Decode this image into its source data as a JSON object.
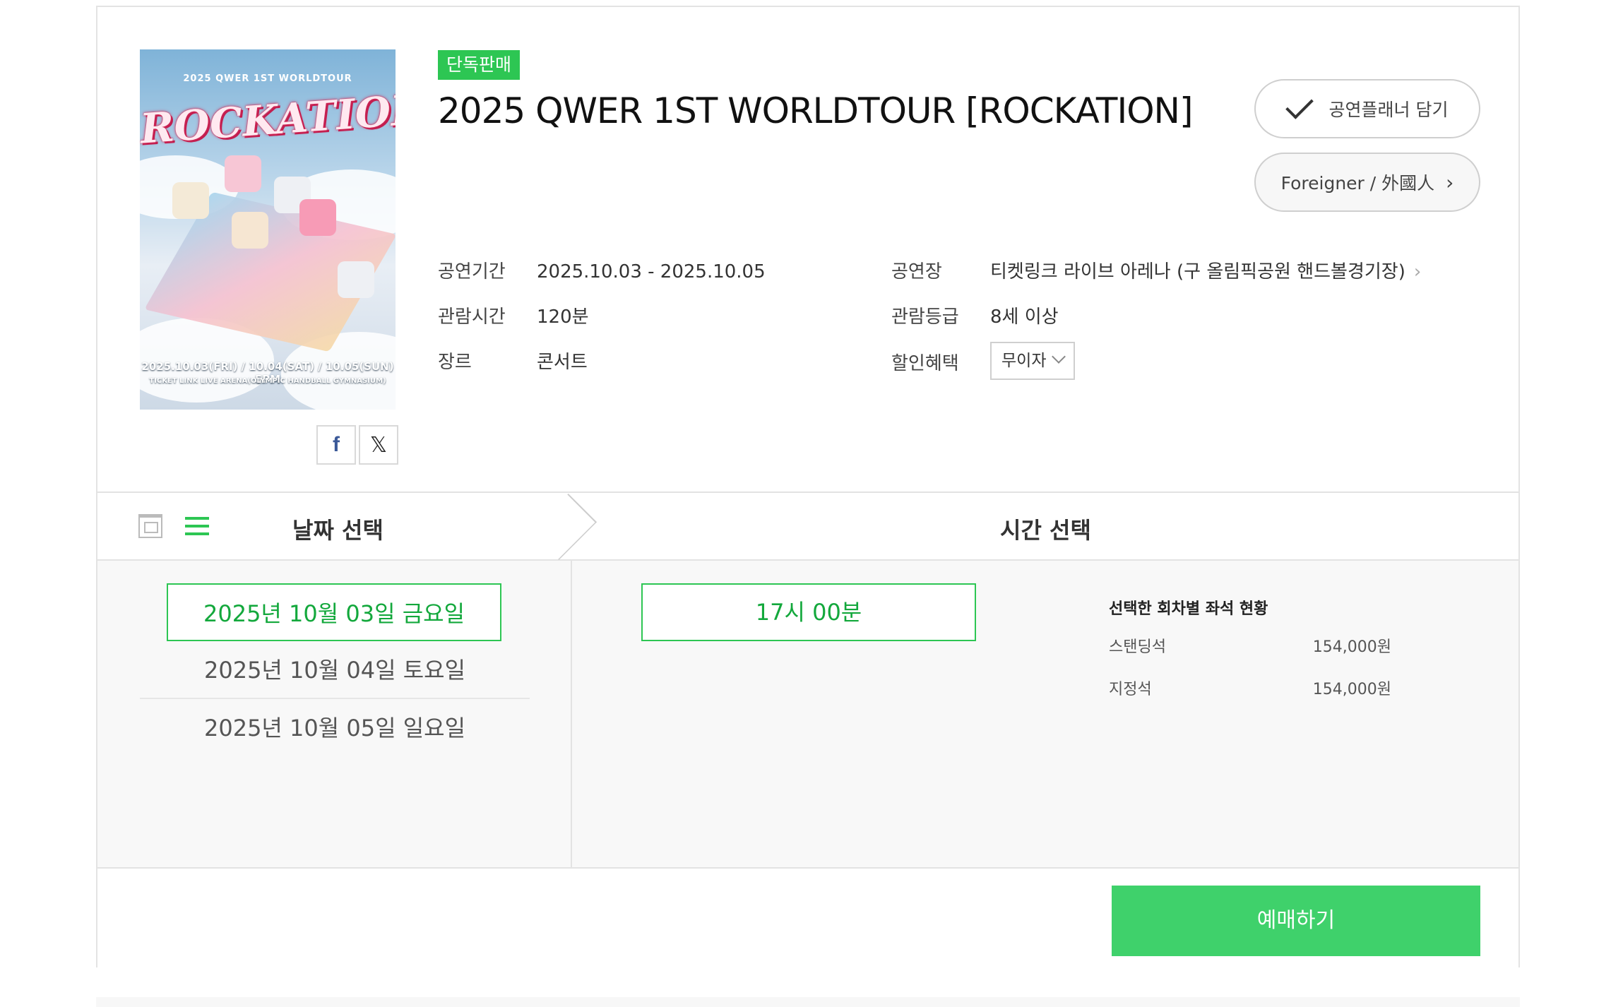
{
  "poster": {
    "top_line": "2025 QWER 1ST WORLDTOUR",
    "logo": "ROCKATION",
    "date_line": "2025.10.03(FRI) / 10.04(SAT) / 10.05(SUN) 5PM",
    "venue_line": "TICKET LINK LIVE ARENA(OLYMPIC HANDBALL GYMNASIUM)"
  },
  "share": {
    "facebook": "f",
    "x": "𝕏"
  },
  "badge": "단독판매",
  "title": "2025 QWER 1ST WORLDTOUR [ROCKATION]",
  "buttons": {
    "planner": "공연플래너 담기",
    "foreigner": "Foreigner / 外國人",
    "book": "예매하기"
  },
  "info": {
    "period_label": "공연기간",
    "period_value": "2025.10.03 - 2025.10.05",
    "runtime_label": "관람시간",
    "runtime_value": "120분",
    "genre_label": "장르",
    "genre_value": "콘서트",
    "venue_label": "공연장",
    "venue_value": "티켓링크 라이브 아레나 (구 올림픽공원 핸드볼경기장)",
    "rating_label": "관람등급",
    "rating_value": "8세 이상",
    "discount_label": "할인혜택",
    "discount_selected": "무이자"
  },
  "selection": {
    "date_header": "날짜 선택",
    "time_header": "시간 선택",
    "dates": [
      "2025년 10월 03일 금요일",
      "2025년 10월 04일 토요일",
      "2025년 10월 05일 일요일"
    ],
    "times": [
      "17시 00분"
    ],
    "seat_status_title": "선택한 회차별 좌석 현황",
    "seats": [
      {
        "name": "스탠딩석",
        "price": "154,000원"
      },
      {
        "name": "지정석",
        "price": "154,000원"
      }
    ]
  },
  "colors": {
    "accent": "#2dc653",
    "button": "#3fd16b"
  }
}
